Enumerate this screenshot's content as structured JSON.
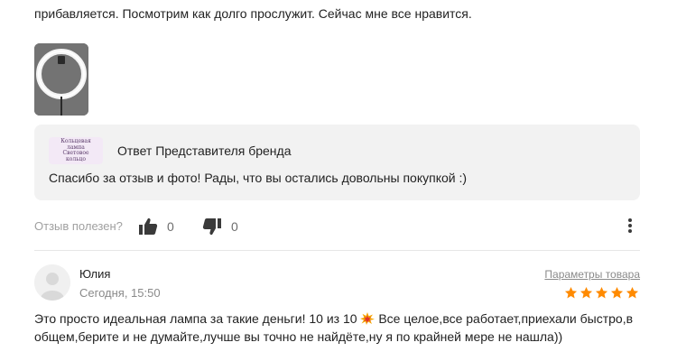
{
  "previous_review": {
    "text_tail": "прибавляется. Посмотрим как долго прослужит. Сейчас мне все нравится."
  },
  "brand_reply": {
    "logo_lines": [
      "Кольцевая",
      "лампа",
      "Световое",
      "кольцо"
    ],
    "title": "Ответ Представителя бренда",
    "text": "Спасибо за отзыв и фото! Рады, что вы остались довольны покупкой :)"
  },
  "helpful": {
    "label": "Отзыв полезен?",
    "likes": "0",
    "dislikes": "0"
  },
  "review": {
    "author": "Юлия",
    "date": "Сегодня, 15:50",
    "params_link": "Параметры товара",
    "rating": 5,
    "text_part1": "Это просто идеальная лампа за такие деньги! 10 из 10",
    "text_part2": " Все целое,все работает,приехали быстро,в общем,берите и не думайте,лучше вы точно не найдёте,ну я по крайней мере не нашла))"
  },
  "colors": {
    "star": "#ff8a00",
    "box_bg": "#f2f2f2",
    "muted": "#a0a0a0"
  }
}
